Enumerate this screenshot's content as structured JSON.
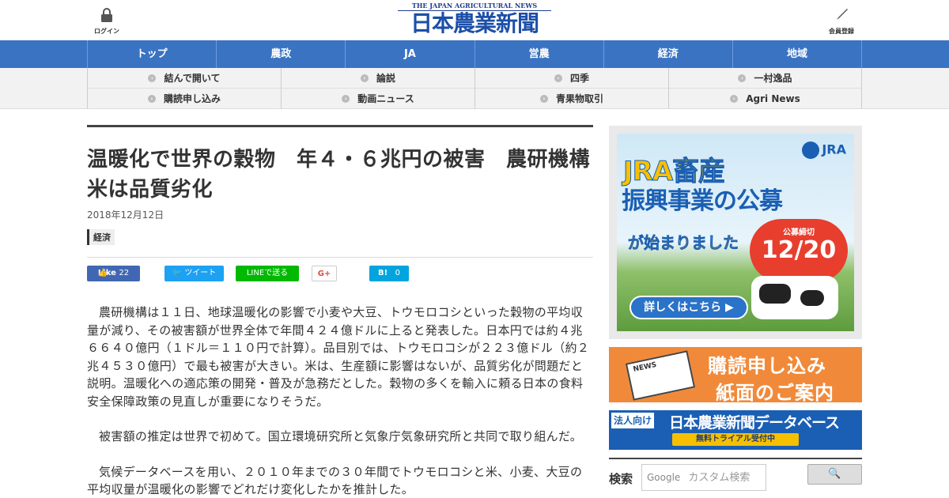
{
  "header": {
    "login_label": "ログイン",
    "member_label": "会員登録",
    "logo_en": "THE JAPAN AGRICULTURAL NEWS",
    "logo_jp": "日本農業新聞"
  },
  "main_nav": [
    "トップ",
    "農政",
    "JA",
    "営農",
    "経済",
    "地域"
  ],
  "sub_nav": [
    "結んで開いて",
    "論説",
    "四季",
    "一村逸品",
    "購読申し込み",
    "動画ニュース",
    "青果物取引",
    "Agri News"
  ],
  "article": {
    "title": "温暖化で世界の穀物　年４・６兆円の被害　農研機構　米は品質劣化",
    "date": "2018年12月12日",
    "category": "経済",
    "share": {
      "facebook": "Like",
      "facebook_count": "22",
      "twitter": "ツイート",
      "line": "LINEで送る",
      "gplus": "G+",
      "hatena": "B!",
      "hatena_count": "0"
    },
    "paragraphs": [
      "農研機構は１１日、地球温暖化の影響で小麦や大豆、トウモロコシといった穀物の平均収量が減り、その被害額が世界全体で年間４２４億ドルに上ると発表した。日本円では約４兆６６４０億円（１ドル＝１１０円で計算）。品目別では、トウモロコシが２２３億ドル（約２兆４５３０億円）で最も被害が大きい。米は、生産額に影響はないが、品質劣化が問題だと説明。温暖化への適応策の開発・普及が急務だとした。穀物の多くを輸入に頼る日本の食料安全保障政策の見直しが重要になりそうだ。",
      "被害額の推定は世界で初めて。国立環境研究所と気象庁気象研究所と共同で取り組んだ。",
      "気候データベースを用い、２０１０年までの３０年間でトウモロコシと米、小麦、大豆の平均収量が温暖化の影響でどれだけ変化したかを推計した。"
    ]
  },
  "sidebar": {
    "jra": {
      "logo": "JRA",
      "line1": "JRA畜産",
      "line2": "振興事業の公募",
      "line3": "が始まりました",
      "deadline_label": "公募締切",
      "deadline_date": "12/20",
      "button": "詳しくはこちら"
    },
    "subscribe": {
      "news": "NEWS",
      "line1": "購読申し込み",
      "line2": "紙面のご案内"
    },
    "database": {
      "tag": "法人向け",
      "title": "日本農業新聞データベース",
      "sub": "無料トライアル受付中"
    },
    "search": {
      "label": "検索",
      "google": "Google",
      "placeholder": "カスタム検索",
      "button": "🔍"
    }
  }
}
